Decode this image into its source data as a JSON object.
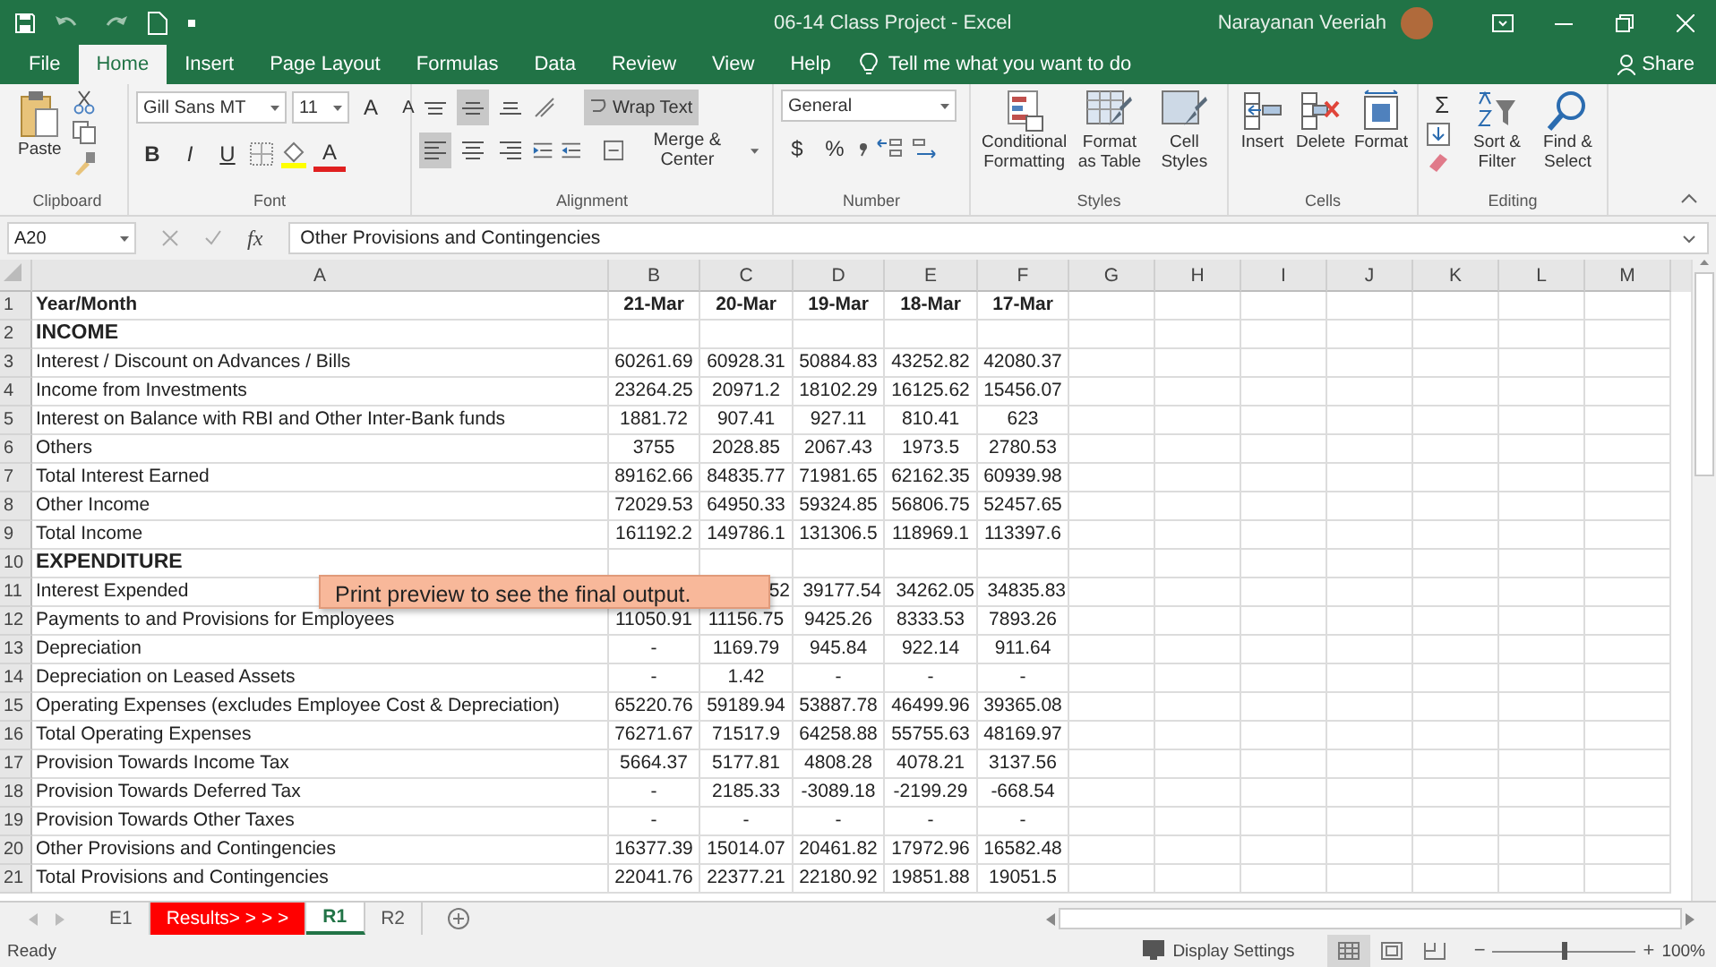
{
  "window": {
    "title": "06-14 Class Project  -  Excel",
    "user": "Narayanan Veeriah"
  },
  "ribbon_tabs": [
    {
      "label": "File",
      "selected": false
    },
    {
      "label": "Home",
      "selected": true
    },
    {
      "label": "Insert",
      "selected": false
    },
    {
      "label": "Page Layout",
      "selected": false
    },
    {
      "label": "Formulas",
      "selected": false
    },
    {
      "label": "Data",
      "selected": false
    },
    {
      "label": "Review",
      "selected": false
    },
    {
      "label": "View",
      "selected": false
    },
    {
      "label": "Help",
      "selected": false
    }
  ],
  "tell_me": {
    "placeholder": "Tell me what you want to do"
  },
  "share": "Share",
  "clipboard": {
    "paste": "Paste",
    "label": "Clipboard"
  },
  "font": {
    "family": "Gill Sans MT",
    "size": "11",
    "grow": "A",
    "shrink": "A",
    "bold": "B",
    "italic": "I",
    "underline": "U",
    "color_button": "A",
    "label": "Font"
  },
  "alignment": {
    "vertical": [
      {
        "kind": "top",
        "selected": false
      },
      {
        "kind": "middle",
        "selected": true
      },
      {
        "kind": "bottom",
        "selected": false
      }
    ],
    "horizontal": [
      {
        "kind": "left",
        "selected": true
      },
      {
        "kind": "center",
        "selected": false
      },
      {
        "kind": "right",
        "selected": false
      }
    ],
    "wrap_text": {
      "label": "Wrap Text",
      "on": true
    },
    "merge": "Merge & Center",
    "label": "Alignment"
  },
  "number": {
    "format": "General",
    "currency": "$",
    "percent": "%",
    "label": "Number"
  },
  "styles": {
    "buttons": [
      {
        "kind": "conditional",
        "label": "Conditional Formatting"
      },
      {
        "kind": "table",
        "label": "Format as Table"
      },
      {
        "kind": "cell",
        "label": "Cell Styles"
      }
    ],
    "label": "Styles"
  },
  "cells": {
    "buttons": [
      {
        "kind": "insert",
        "label": "Insert"
      },
      {
        "kind": "delete",
        "label": "Delete"
      },
      {
        "kind": "format",
        "label": "Format"
      }
    ],
    "label": "Cells"
  },
  "editing": {
    "sum": "Σ",
    "sort": "Sort & Filter",
    "find": "Find & Select",
    "label": "Editing"
  },
  "formula_bar": {
    "name_box": "A20",
    "function_symbol": "fx",
    "formula": "Other Provisions and Contingencies"
  },
  "grid": {
    "columns": [
      "A",
      "B",
      "C",
      "D",
      "E",
      "F",
      "G",
      "H",
      "I",
      "J",
      "K",
      "L",
      "M"
    ],
    "rows": [
      {
        "number": "1",
        "kind": "header",
        "label": "Year/Month",
        "values": [
          "21-Mar",
          "20-Mar",
          "19-Mar",
          "18-Mar",
          "17-Mar"
        ]
      },
      {
        "number": "2",
        "kind": "section",
        "label": "INCOME",
        "values": []
      },
      {
        "number": "3",
        "kind": "data",
        "label": "Interest / Discount on Advances / Bills",
        "values": [
          "60261.69",
          "60928.31",
          "50884.83",
          "43252.82",
          "42080.37"
        ]
      },
      {
        "number": "4",
        "kind": "data",
        "label": "Income from Investments",
        "values": [
          "23264.25",
          "20971.2",
          "18102.29",
          "16125.62",
          "15456.07"
        ]
      },
      {
        "number": "5",
        "kind": "data",
        "label": "Interest on Balance with RBI and Other Inter-Bank funds",
        "values": [
          "1881.72",
          "907.41",
          "927.11",
          "810.41",
          "623"
        ]
      },
      {
        "number": "6",
        "kind": "data",
        "label": "Others",
        "values": [
          "3755",
          "2028.85",
          "2067.43",
          "1973.5",
          "2780.53"
        ]
      },
      {
        "number": "7",
        "kind": "data",
        "label": "Total Interest Earned",
        "values": [
          "89162.66",
          "84835.77",
          "71981.65",
          "62162.35",
          "60939.98"
        ]
      },
      {
        "number": "8",
        "kind": "data",
        "label": "Other Income",
        "values": [
          "72029.53",
          "64950.33",
          "59324.85",
          "56806.75",
          "52457.65"
        ]
      },
      {
        "number": "9",
        "kind": "data",
        "label": "Total Income",
        "values": [
          "161192.2",
          "149786.1",
          "131306.5",
          "118969.1",
          "113397.6"
        ]
      },
      {
        "number": "10",
        "kind": "section",
        "label": "EXPENDITURE",
        "values": []
      },
      {
        "number": "11",
        "kind": "covered",
        "label": "Interest Expended",
        "values": [
          "52",
          "39177.54",
          "34262.05",
          "34835.83"
        ]
      },
      {
        "number": "12",
        "kind": "data",
        "label": "Payments to and Provisions for Employees",
        "values": [
          "11050.91",
          "11156.75",
          "9425.26",
          "8333.53",
          "7893.26"
        ]
      },
      {
        "number": "13",
        "kind": "data",
        "label": "Depreciation",
        "values": [
          "-",
          "1169.79",
          "945.84",
          "922.14",
          "911.64"
        ]
      },
      {
        "number": "14",
        "kind": "data",
        "label": "Depreciation on Leased Assets",
        "values": [
          "-",
          "1.42",
          "-",
          "-",
          "-"
        ]
      },
      {
        "number": "15",
        "kind": "data",
        "label": "Operating Expenses (excludes Employee Cost & Depreciation)",
        "values": [
          "65220.76",
          "59189.94",
          "53887.78",
          "46499.96",
          "39365.08"
        ]
      },
      {
        "number": "16",
        "kind": "data",
        "label": "Total Operating Expenses",
        "values": [
          "76271.67",
          "71517.9",
          "64258.88",
          "55755.63",
          "48169.97"
        ]
      },
      {
        "number": "17",
        "kind": "data",
        "label": "Provision Towards Income Tax",
        "values": [
          "5664.37",
          "5177.81",
          "4808.28",
          "4078.21",
          "3137.56"
        ]
      },
      {
        "number": "18",
        "kind": "data",
        "label": "Provision Towards Deferred Tax",
        "values": [
          "-",
          "2185.33",
          "-3089.18",
          "-2199.29",
          "-668.54"
        ]
      },
      {
        "number": "19",
        "kind": "data",
        "label": "Provision Towards Other Taxes",
        "values": [
          "-",
          "-",
          "-",
          "-",
          "-"
        ]
      },
      {
        "number": "20",
        "kind": "data",
        "label": "Other Provisions and Contingencies",
        "values": [
          "16377.39",
          "15014.07",
          "20461.82",
          "17972.96",
          "16582.48"
        ]
      },
      {
        "number": "21",
        "kind": "data",
        "label": "Total Provisions and Contingencies",
        "values": [
          "22041.76",
          "22377.21",
          "22180.92",
          "19851.88",
          "19051.5"
        ]
      }
    ]
  },
  "tooltip": "Print preview to see the final output.",
  "sheet_tabs": [
    {
      "label": "E1",
      "selected": false
    },
    {
      "label": "Results> > > >",
      "selected": false,
      "color": "#ff0000"
    },
    {
      "label": "R1",
      "selected": true
    },
    {
      "label": "R2",
      "selected": false
    }
  ],
  "status_bar": {
    "mode": "Ready",
    "display_settings": "Display Settings",
    "views": [
      {
        "kind": "normal",
        "selected": true
      },
      {
        "kind": "page-layout",
        "selected": false
      },
      {
        "kind": "page-break",
        "selected": false
      }
    ],
    "zoom": {
      "out": "−",
      "in": "+",
      "level": 0.5,
      "reading": "100%"
    }
  }
}
